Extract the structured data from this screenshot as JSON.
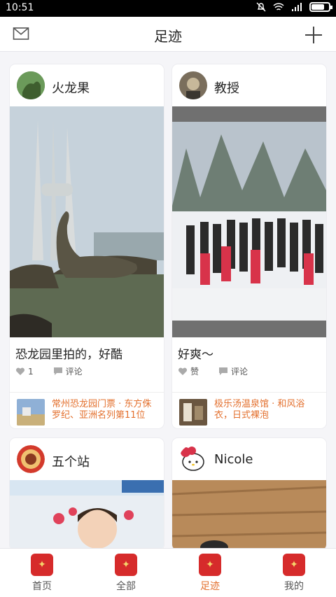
{
  "status_bar": {
    "time": "10:51"
  },
  "header": {
    "title": "足迹"
  },
  "cards": [
    {
      "user": "火龙果",
      "caption": "恐龙园里拍的，好酷",
      "like_label": "1",
      "comment_label": "评论",
      "place": "常州恐龙园门票 · 东方侏罗纪、亚洲名列第11位"
    },
    {
      "user": "教授",
      "caption": "好爽～",
      "like_label": "赞",
      "comment_label": "评论",
      "place": "极乐汤温泉馆 · 和风浴衣，日式裸泡"
    },
    {
      "user": "五个站"
    },
    {
      "user": "Nicole"
    }
  ],
  "tabs": [
    {
      "label": "首页"
    },
    {
      "label": "全部"
    },
    {
      "label": "足迹"
    },
    {
      "label": "我的"
    }
  ],
  "colors": {
    "accent": "#e3702e"
  }
}
